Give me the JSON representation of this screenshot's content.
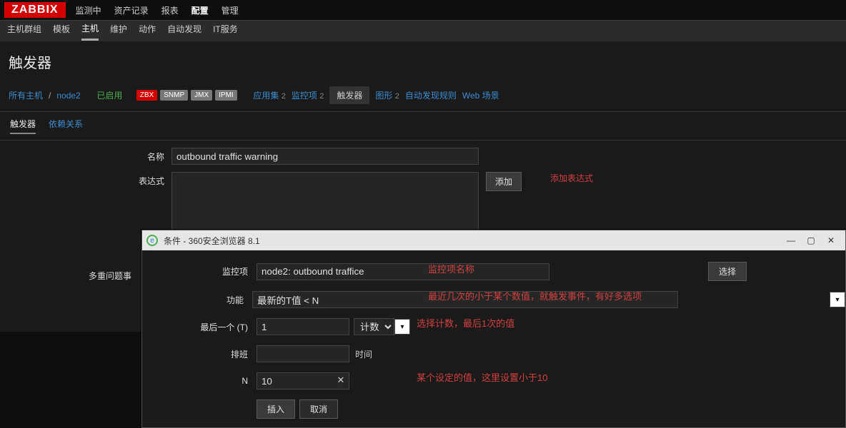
{
  "logo": "ZABBIX",
  "topnav": {
    "items": [
      "监测中",
      "资产记录",
      "报表",
      "配置",
      "管理"
    ],
    "active_index": 3
  },
  "subnav": {
    "items": [
      "主机群组",
      "模板",
      "主机",
      "维护",
      "动作",
      "自动发现",
      "IT服务"
    ],
    "active_index": 2
  },
  "page_title": "触发器",
  "breadcrumb": {
    "all_hosts": "所有主机",
    "host": "node2",
    "enabled": "已启用",
    "pills": [
      "ZBX",
      "SNMP",
      "JMX",
      "IPMI"
    ],
    "tabs": [
      {
        "label": "应用集",
        "count": "2"
      },
      {
        "label": "监控项",
        "count": "2"
      },
      {
        "label": "触发器",
        "active": true
      },
      {
        "label": "图形",
        "count": "2"
      },
      {
        "label": "自动发现规则"
      },
      {
        "label": "Web 场景"
      }
    ]
  },
  "innertabs": {
    "items": [
      "触发器",
      "依赖关系"
    ],
    "active_index": 0
  },
  "form": {
    "name_label": "名称",
    "name_value": "outbound traffic warning",
    "expr_label": "表达式",
    "expr_value": "",
    "add_btn": "添加",
    "add_annot": "添加表达式",
    "multi_label": "多重问题事"
  },
  "modal": {
    "title": "条件 - 360安全浏览器 8.1",
    "rows": {
      "item_label": "监控项",
      "item_value": "node2: outbound traffice",
      "item_select_btn": "选择",
      "func_label": "功能",
      "func_value": "最新的T值 < N",
      "last_label": "最后一个 (T)",
      "last_value": "1",
      "last_unit_options": [
        "计数"
      ],
      "shift_label": "排班",
      "shift_value": "",
      "shift_unit": "时间",
      "n_label": "N",
      "n_value": "10",
      "insert_btn": "插入",
      "cancel_btn": "取消"
    },
    "annotations": {
      "item": "监控项名称",
      "func": "最近几次的小于某个数值，就触发事件，有好多选项",
      "last": "选择计数，最后1次的值",
      "n": "某个设定的值，这里设置小于10"
    },
    "window_controls": {
      "min": "—",
      "max": "▢",
      "close": "✕"
    }
  }
}
